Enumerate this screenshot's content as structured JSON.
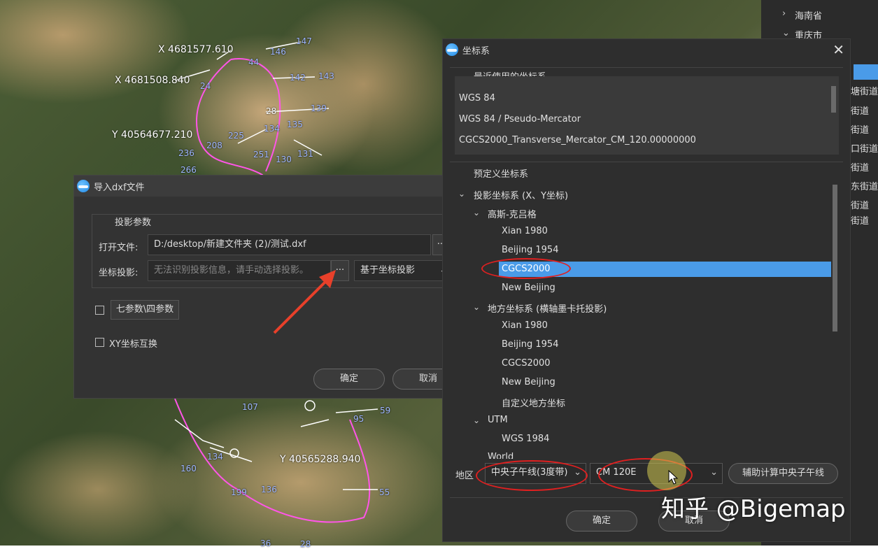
{
  "map": {
    "labels": [
      {
        "text": "X 4681577.610"
      },
      {
        "text": "X 4681508.840"
      },
      {
        "text": "Y 40564677.210"
      },
      {
        "text": "Y 40565288.940"
      }
    ],
    "numbers": [
      "146",
      "44",
      "147",
      "142",
      "143",
      "24",
      "139",
      "28",
      "134",
      "135",
      "225",
      "208",
      "236",
      "251",
      "131",
      "266",
      "130",
      "107",
      "95",
      "59",
      "134",
      "136",
      "199",
      "160",
      "55",
      "36",
      "28"
    ]
  },
  "right_panel": {
    "items": [
      "海南省",
      "重庆市"
    ],
    "right_labels": [
      "塘街道",
      "街道",
      "街道",
      "口街道",
      "街道",
      "东街道",
      "街道",
      "街道"
    ]
  },
  "import_dialog": {
    "title": "导入dxf文件",
    "group_title": "投影参数",
    "open_file_label": "打开文件:",
    "open_file_value": "D:/desktop/新建文件夹 (2)/测试.dxf",
    "browse_label": "···",
    "projection_label": "坐标投影:",
    "projection_placeholder": "无法识别投影信息，请手动选择投影。",
    "projection_browse": "···",
    "projection_mode": "基于坐标投影",
    "seven_params_label": "七参数\\四参数",
    "xy_swap_label": "XY坐标互换",
    "ok": "确定",
    "cancel": "取消"
  },
  "coord_dialog": {
    "title": "坐标系",
    "recent_title": "最近使用的坐标系",
    "recent": [
      "WGS 84",
      "WGS 84 / Pseudo-Mercator",
      "CGCS2000_Transverse_Mercator_CM_120.00000000"
    ],
    "predefined_title": "预定义坐标系",
    "tree": {
      "proj": "投影坐标系 (X、Y坐标)",
      "gk": "高斯-克吕格",
      "gk_items": [
        "Xian 1980",
        "Beijing 1954",
        "CGCS2000",
        "New Beijing"
      ],
      "local": "地方坐标系 (横轴墨卡托投影)",
      "local_items": [
        "Xian 1980",
        "Beijing 1954",
        "CGCS2000",
        "New Beijing",
        "自定义地方坐标"
      ],
      "utm": "UTM",
      "utm_items": [
        "WGS 1984"
      ],
      "world": "World"
    },
    "region_label": "地区",
    "meridian_mode": "中央子午线(3度带)",
    "meridian_value": "CM 120E",
    "calc_button": "辅助计算中央子午线",
    "ok": "确定",
    "cancel": "取消"
  },
  "watermark": "知乎 @Bigemap",
  "colors": {
    "selection": "#4a9be8",
    "annotation": "#e02020",
    "arrow": "#e8402a"
  }
}
